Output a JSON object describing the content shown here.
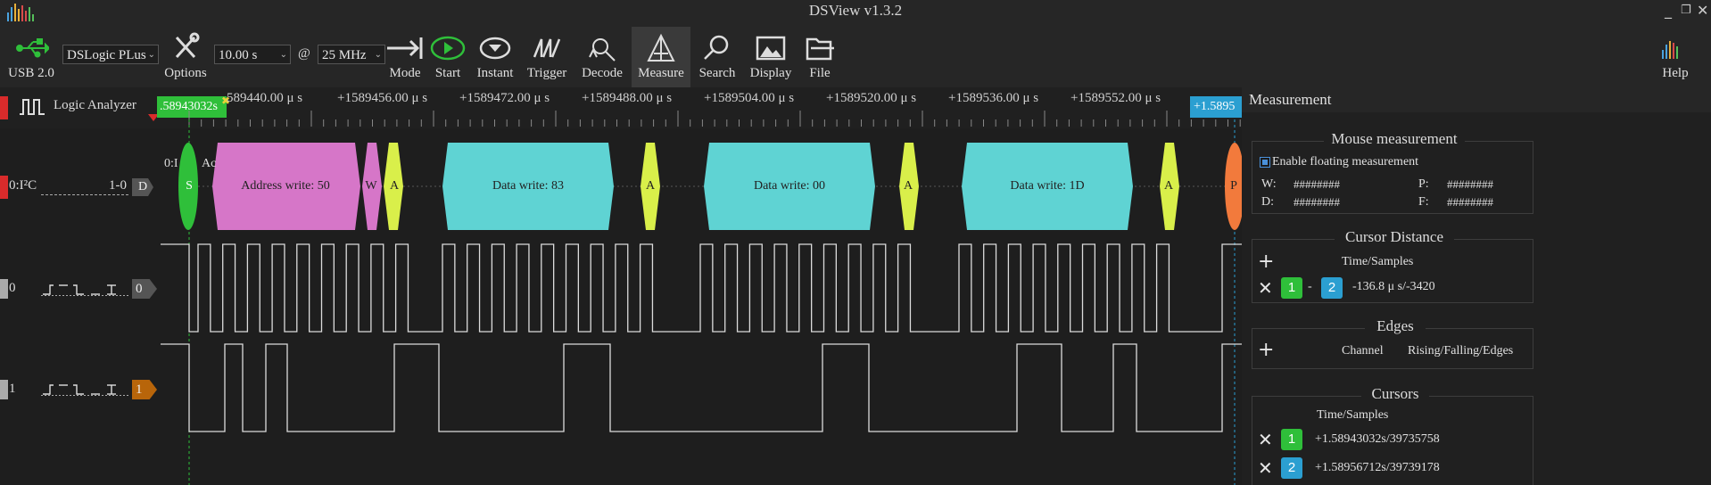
{
  "window": {
    "title": "DSView v1.3.2",
    "min": "_",
    "restore": "❐",
    "close": "✕"
  },
  "toolbar": {
    "usb_label": "USB 2.0",
    "device": "DSLogic PLus",
    "options_label": "Options",
    "duration": "10.00 s",
    "at": "@",
    "rate": "25 MHz",
    "mode_label": "Mode",
    "start_label": "Start",
    "instant_label": "Instant",
    "trigger_label": "Trigger",
    "decode_label": "Decode",
    "measure_label": "Measure",
    "search_label": "Search",
    "display_label": "Display",
    "file_label": "File",
    "help_label": "Help"
  },
  "ruler": {
    "cursor1_label": ".58943032s",
    "cursor2_label": "+1.5895",
    "ticks": [
      "+1589440.00 μ s",
      "+1589456.00 μ s",
      "+1589472.00 μ s",
      "+1589488.00 μ s",
      "+1589504.00 μ s",
      "+1589520.00 μ s",
      "+1589536.00 μ s",
      "+1589552.00 μ s"
    ],
    "first_tick": "589440.00 μ s"
  },
  "channels": {
    "analyzer": "Logic Analyzer",
    "decoder_name": "0:I²C",
    "decoder_range": "1-0",
    "decoder_tag": "D",
    "decoder_inner": "0:I",
    "decoder_inner2": "Ac",
    "ch0_index": "0",
    "ch0_tag": "0",
    "ch1_index": "1",
    "ch1_tag": "1"
  },
  "packets": {
    "start": "S",
    "addr": "Address write: 50",
    "w": "W",
    "a1": "A",
    "d1": "Data write: 83",
    "a2": "A",
    "d2": "Data write: 00",
    "a3": "A",
    "d3": "Data write: 1D",
    "a4": "A",
    "stop": "P"
  },
  "panel": {
    "title": "Measurement",
    "mouse_title": "Mouse measurement",
    "floating_label": "Enable floating measurement",
    "w_label": "W:",
    "w_val": "########",
    "p_label": "P:",
    "p_val": "########",
    "d_label": "D:",
    "d_val": "########",
    "f_label": "F:",
    "f_val": "########",
    "cursor_dist_title": "Cursor Distance",
    "ts_header": "Time/Samples",
    "dist_c1": "1",
    "dist_sep": "-",
    "dist_c2": "2",
    "dist_value": "-136.8 μ s/-3420",
    "edges_title": "Edges",
    "channel_header": "Channel",
    "rfe_header": "Rising/Falling/Edges",
    "cursors_title": "Cursors",
    "cursors_ts_header": "Time/Samples",
    "cur1_id": "1",
    "cur1_value": "+1.58943032s/39735758",
    "cur2_id": "2",
    "cur2_value": "+1.58956712s/39739178"
  },
  "colors": {
    "green_cursor": "#2fbf3a",
    "blue_cursor": "#2b9fd1",
    "addr": "#d676c8",
    "data": "#5fd3d3",
    "ack": "#d9ef4a",
    "stop": "#f27a3c"
  }
}
